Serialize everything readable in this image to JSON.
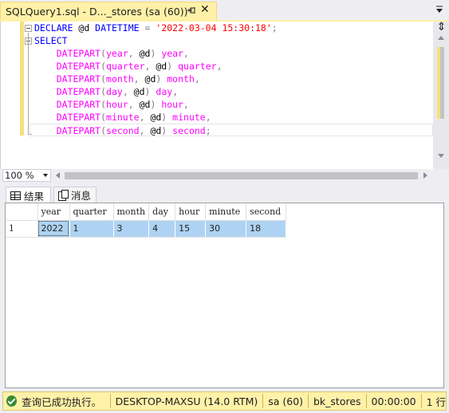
{
  "window": {
    "tab_title": "SQLQuery1.sql - D..._stores (sa (60))*",
    "pin_icon": "pin-icon",
    "close_glyph": "✕"
  },
  "editor": {
    "lines": [
      {
        "parts": [
          [
            "kw",
            "DECLARE"
          ],
          [
            "tx",
            " @d "
          ],
          [
            "kw",
            "DATETIME"
          ],
          [
            "tx",
            " "
          ],
          [
            "op",
            "="
          ],
          [
            "tx",
            " "
          ],
          [
            "str",
            "'2022-03-04 15:30:18'"
          ],
          [
            "op",
            ";"
          ]
        ]
      },
      {
        "parts": [
          [
            "kw",
            "SELECT"
          ]
        ]
      },
      {
        "parts": [
          [
            "tx",
            "    "
          ],
          [
            "fn",
            "DATEPART"
          ],
          [
            "op",
            "("
          ],
          [
            "arg",
            "year"
          ],
          [
            "op",
            ","
          ],
          [
            "tx",
            " @d"
          ],
          [
            "op",
            ")"
          ],
          [
            "tx",
            " "
          ],
          [
            "fn",
            "year"
          ],
          [
            "op",
            ","
          ]
        ]
      },
      {
        "parts": [
          [
            "tx",
            "    "
          ],
          [
            "fn",
            "DATEPART"
          ],
          [
            "op",
            "("
          ],
          [
            "arg",
            "quarter"
          ],
          [
            "op",
            ","
          ],
          [
            "tx",
            " @d"
          ],
          [
            "op",
            ")"
          ],
          [
            "tx",
            " "
          ],
          [
            "fn",
            "quarter"
          ],
          [
            "op",
            ","
          ]
        ]
      },
      {
        "parts": [
          [
            "tx",
            "    "
          ],
          [
            "fn",
            "DATEPART"
          ],
          [
            "op",
            "("
          ],
          [
            "arg",
            "month"
          ],
          [
            "op",
            ","
          ],
          [
            "tx",
            " @d"
          ],
          [
            "op",
            ")"
          ],
          [
            "tx",
            " "
          ],
          [
            "fn",
            "month"
          ],
          [
            "op",
            ","
          ]
        ]
      },
      {
        "parts": [
          [
            "tx",
            "    "
          ],
          [
            "fn",
            "DATEPART"
          ],
          [
            "op",
            "("
          ],
          [
            "arg",
            "day"
          ],
          [
            "op",
            ","
          ],
          [
            "tx",
            " @d"
          ],
          [
            "op",
            ")"
          ],
          [
            "tx",
            " "
          ],
          [
            "fn",
            "day"
          ],
          [
            "op",
            ","
          ]
        ]
      },
      {
        "parts": [
          [
            "tx",
            "    "
          ],
          [
            "fn",
            "DATEPART"
          ],
          [
            "op",
            "("
          ],
          [
            "arg",
            "hour"
          ],
          [
            "op",
            ","
          ],
          [
            "tx",
            " @d"
          ],
          [
            "op",
            ")"
          ],
          [
            "tx",
            " "
          ],
          [
            "fn",
            "hour"
          ],
          [
            "op",
            ","
          ]
        ]
      },
      {
        "parts": [
          [
            "tx",
            "    "
          ],
          [
            "fn",
            "DATEPART"
          ],
          [
            "op",
            "("
          ],
          [
            "arg",
            "minute"
          ],
          [
            "op",
            ","
          ],
          [
            "tx",
            " @d"
          ],
          [
            "op",
            ")"
          ],
          [
            "tx",
            " "
          ],
          [
            "fn",
            "minute"
          ],
          [
            "op",
            ","
          ]
        ]
      },
      {
        "parts": [
          [
            "tx",
            "    "
          ],
          [
            "fn",
            "DATEPART"
          ],
          [
            "op",
            "("
          ],
          [
            "arg",
            "second"
          ],
          [
            "op",
            ","
          ],
          [
            "tx",
            " @d"
          ],
          [
            "op",
            ")"
          ],
          [
            "tx",
            " "
          ],
          [
            "fn",
            "second"
          ],
          [
            "op",
            ";"
          ]
        ]
      }
    ],
    "zoom": "100 %"
  },
  "results": {
    "tabs": [
      {
        "label": "结果",
        "icon": "grid-icon"
      },
      {
        "label": "消息",
        "icon": "messages-icon"
      }
    ],
    "columns": [
      "year",
      "quarter",
      "month",
      "day",
      "hour",
      "minute",
      "second"
    ],
    "rows": [
      {
        "num": "1",
        "cells": [
          "2022",
          "1",
          "3",
          "4",
          "15",
          "30",
          "18"
        ]
      }
    ]
  },
  "statusbar": {
    "message": "查询已成功执行。",
    "server": "DESKTOP-MAXSU (14.0 RTM)",
    "user": "sa (60)",
    "database": "bk_stores",
    "elapsed": "00:00:00",
    "rows": "1 行"
  },
  "colors": {
    "tab_active": "#fff1a8",
    "keyword": "#0000ff",
    "function": "#ff00ff",
    "string": "#ff0000",
    "selection": "#aed3f2",
    "status_ok": "#388a34"
  }
}
